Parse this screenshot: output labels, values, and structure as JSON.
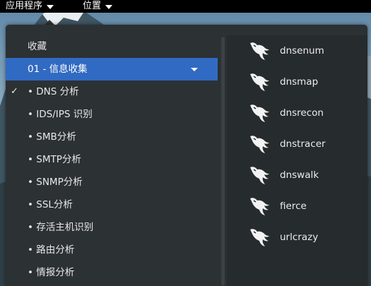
{
  "top_panel": {
    "applications_label": "应用程序",
    "places_label": "位置"
  },
  "categories": [
    {
      "label": "收藏",
      "selected": false,
      "checked": false
    },
    {
      "label": "01 - 信息收集",
      "selected": true,
      "checked": false
    },
    {
      "label": "• DNS 分析",
      "selected": false,
      "checked": true
    },
    {
      "label": "• IDS/IPS 识别",
      "selected": false,
      "checked": false
    },
    {
      "label": "• SMB分析",
      "selected": false,
      "checked": false
    },
    {
      "label": "• SMTP分析",
      "selected": false,
      "checked": false
    },
    {
      "label": "• SNMP分析",
      "selected": false,
      "checked": false
    },
    {
      "label": "• SSL分析",
      "selected": false,
      "checked": false
    },
    {
      "label": "• 存活主机识别",
      "selected": false,
      "checked": false
    },
    {
      "label": "• 路由分析",
      "selected": false,
      "checked": false
    },
    {
      "label": "• 情报分析",
      "selected": false,
      "checked": false
    }
  ],
  "check_mark": "✓",
  "apps": [
    {
      "label": "dnsenum",
      "icon": "kali-dragon-icon"
    },
    {
      "label": "dnsmap",
      "icon": "kali-dragon-icon"
    },
    {
      "label": "dnsrecon",
      "icon": "kali-dragon-icon"
    },
    {
      "label": "dnstracer",
      "icon": "kali-dragon-icon"
    },
    {
      "label": "dnswalk",
      "icon": "kali-dragon-icon"
    },
    {
      "label": "fierce",
      "icon": "kali-dragon-icon"
    },
    {
      "label": "urlcrazy",
      "icon": "kali-dragon-icon"
    }
  ],
  "colors": {
    "panel_bg": "#000000",
    "menu_bg": "#2c3133",
    "apps_bg": "#262b2d",
    "selected_bg": "#316ac2",
    "text": "#e8e8e8"
  }
}
